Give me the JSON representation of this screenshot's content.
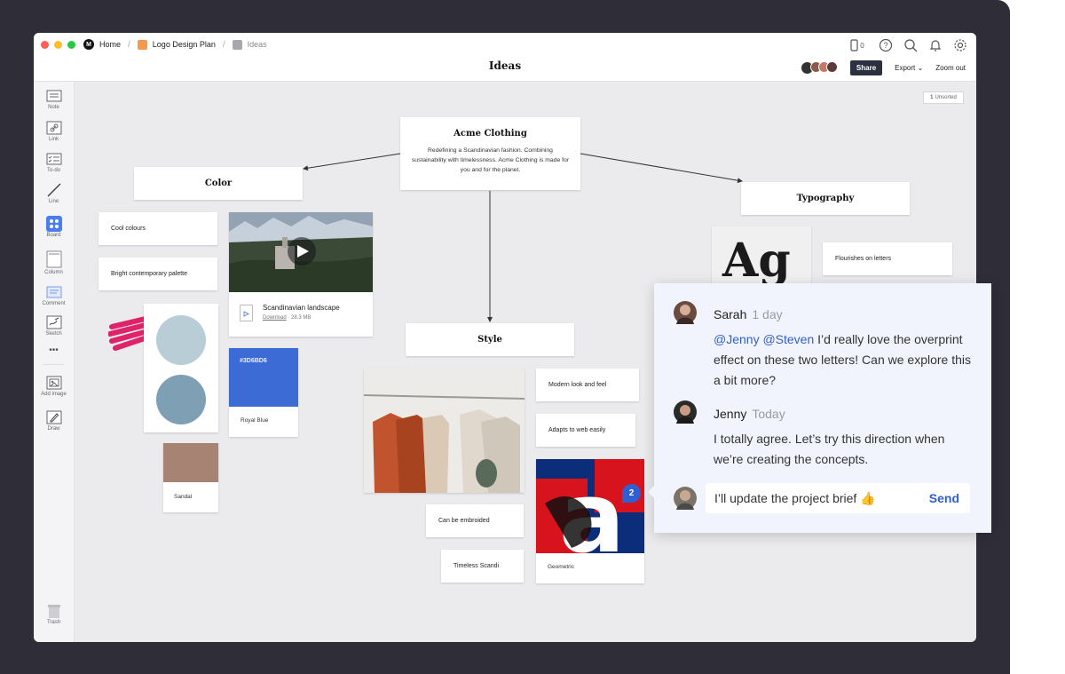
{
  "topbar": {
    "breadcrumbs": [
      "Home",
      "Logo Design Plan",
      "Ideas"
    ],
    "board_title": "Ideas",
    "device_count": "0",
    "share_label": "Share",
    "export_label": "Export",
    "zoom_label": "Zoom out"
  },
  "sidebar": {
    "tools": [
      "Note",
      "Link",
      "To-do",
      "Line",
      "Board",
      "Column",
      "Comment",
      "Sketch",
      "Add image",
      "Draw"
    ],
    "trash": "Trash"
  },
  "canvas": {
    "unsorted_count": "1",
    "unsorted_label": "Unsorted",
    "main_card": {
      "title": "Acme Clothing",
      "body": "Redefining a Scandinavian fashion. Combining sustainability with timelessness. Acme Clothing is made for you and for the planet."
    },
    "headers": {
      "color": "Color",
      "typography": "Typography",
      "style": "Style"
    },
    "notes": {
      "cool_colours": "Cool colours",
      "bright_palette": "Bright contemporary palette",
      "flourishes": "Flourishes on letters",
      "modern_look": "Modern look and feel",
      "adapts_web": "Adapts to web easily",
      "embroided": "Can be embroided",
      "timeless": "Timeless Scandi"
    },
    "video": {
      "title": "Scandinavian landscape",
      "download": "Download",
      "size": "28.3 MB"
    },
    "swatches": {
      "royal_blue_hex": "#3D6BD6",
      "royal_blue_label": "Royal Blue",
      "sandal_label": "Sandal",
      "sandal_color": "#a68372",
      "circle1": "#b8cdd5",
      "circle2": "#7f9fb4"
    },
    "typography_glyph": "Ag",
    "geometric_glyph": "a",
    "geometric_label": "Geometric",
    "badge_count": "2"
  },
  "comments": [
    {
      "author": "Sarah",
      "time": "1 day",
      "mentions": "@Jenny @Steven",
      "text": " I’d really love the overprint effect on these two letters! Can we explore this a bit more?"
    },
    {
      "author": "Jenny",
      "time": "Today",
      "text": "I totally agree. Let’s try this direction when we’re creating the concepts."
    }
  ],
  "reply": {
    "text": "I’ll update the project brief 👍",
    "send_label": "Send"
  },
  "colors": {
    "accent": "#2f5fd0",
    "frame": "#2f2e38",
    "canvas_bg": "#ebebee"
  }
}
